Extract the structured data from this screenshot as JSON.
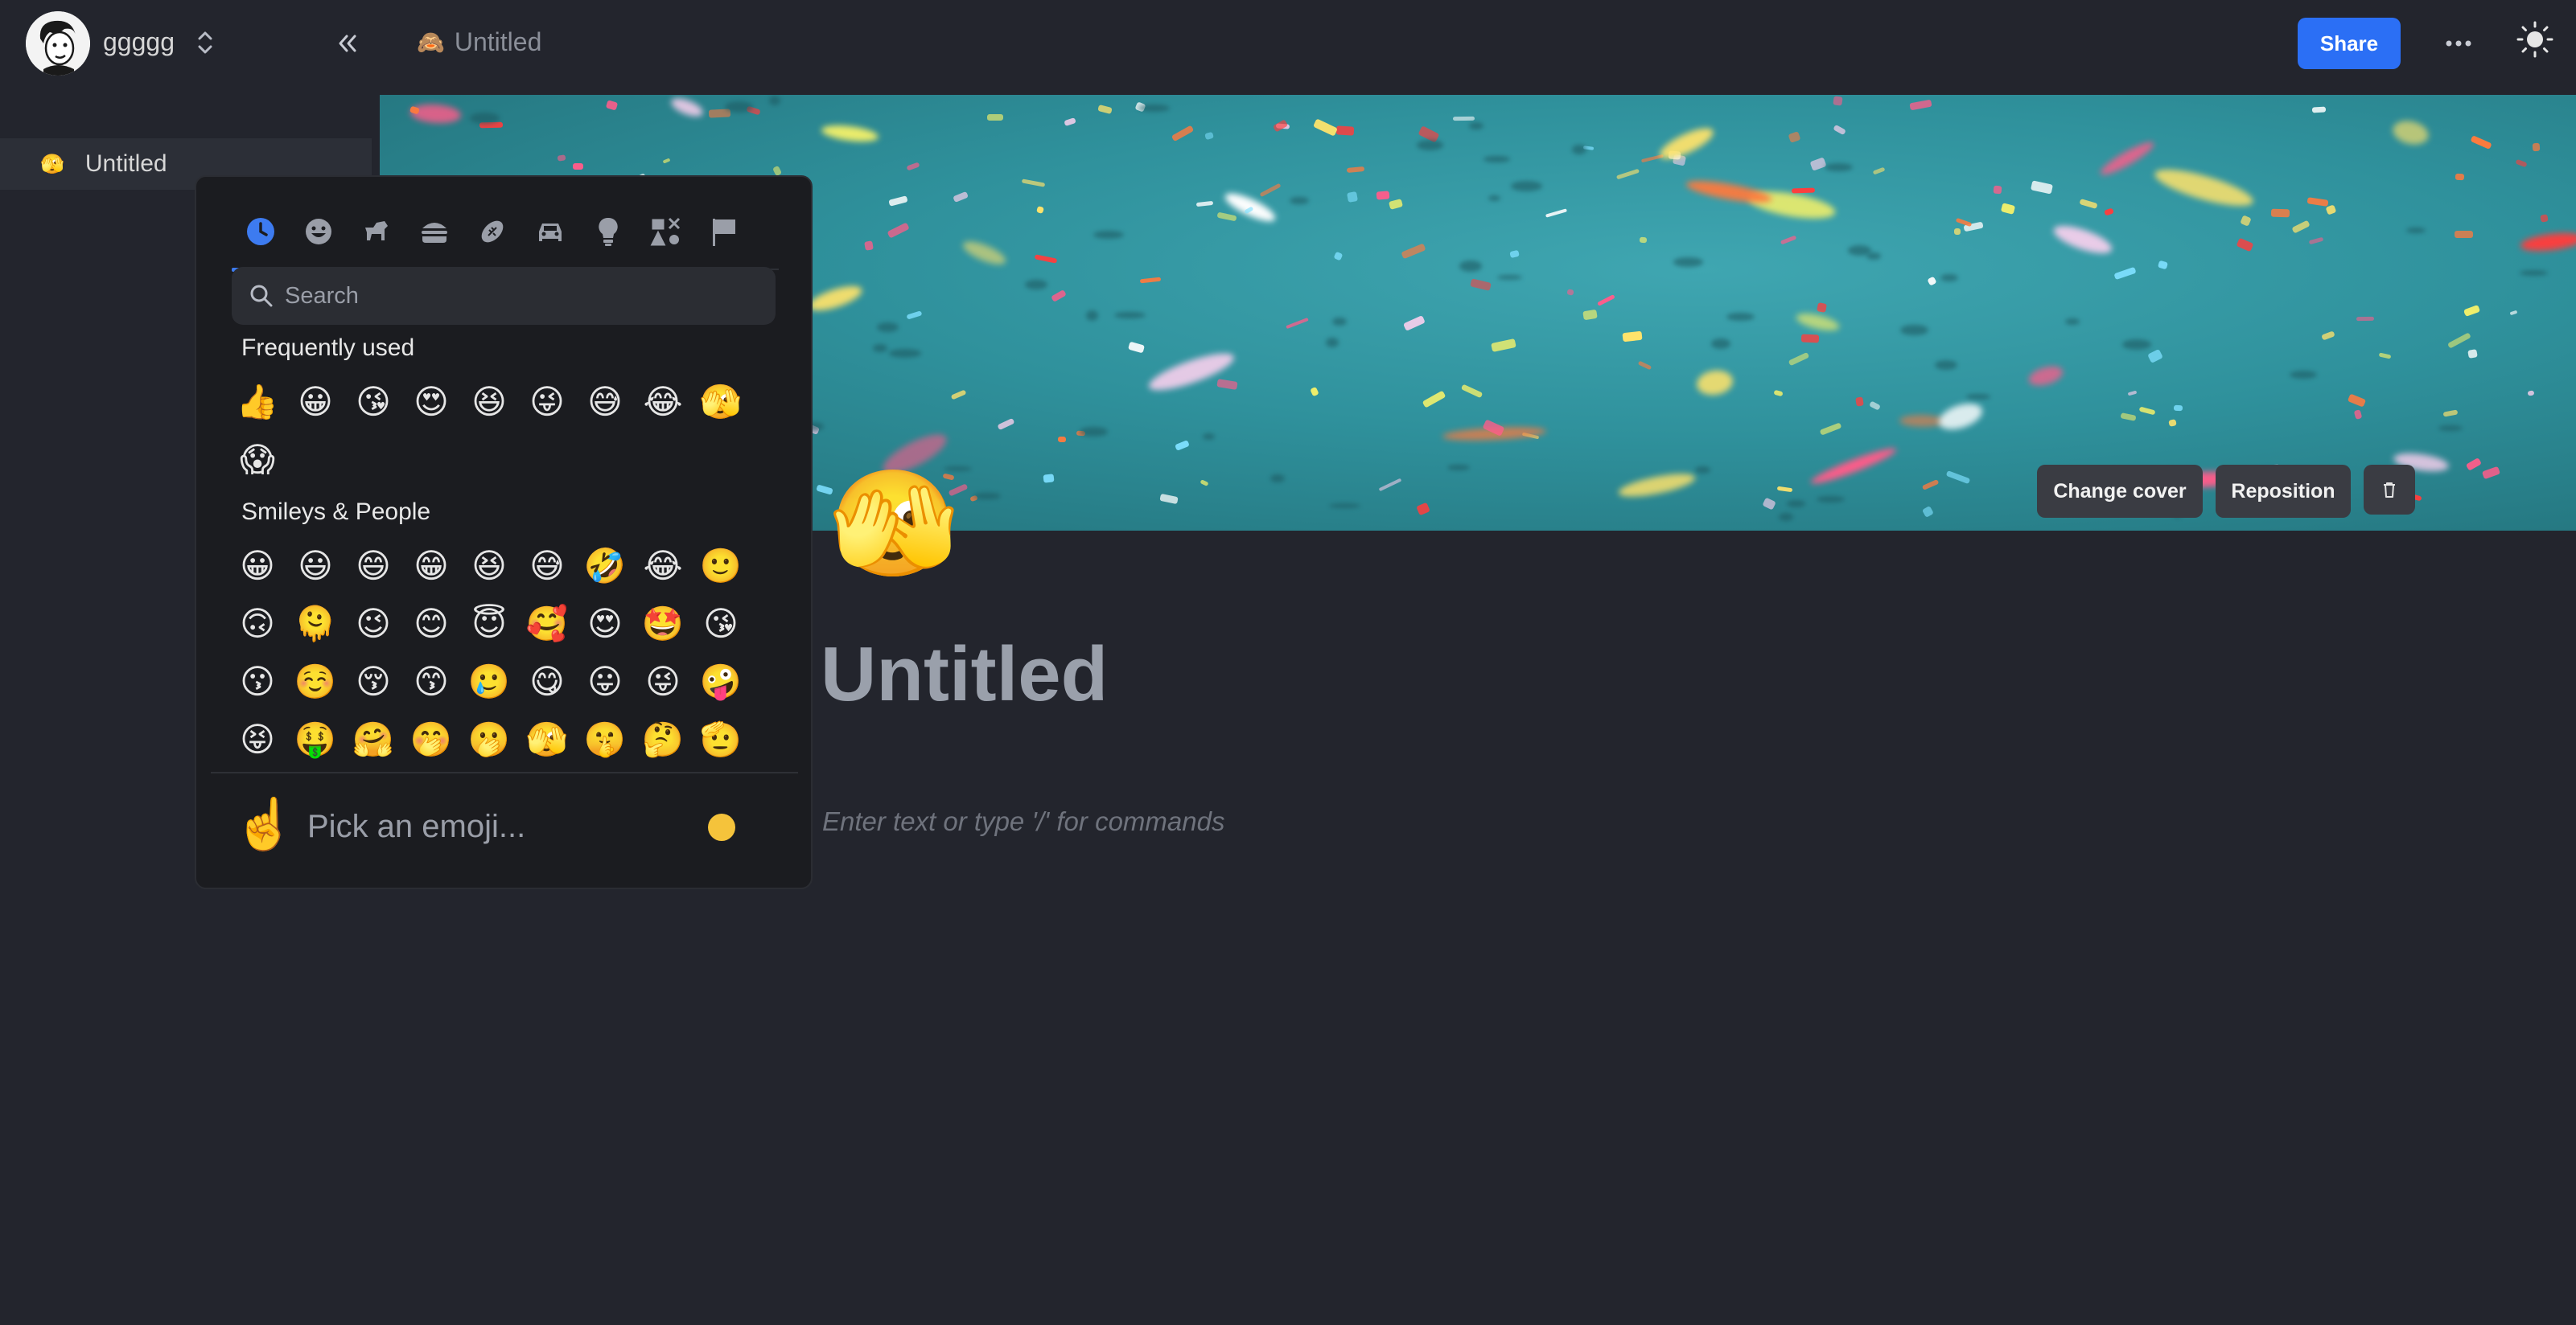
{
  "header": {
    "workspace_name": "ggggg",
    "breadcrumb_icon": "🙈",
    "breadcrumb_title": "Untitled",
    "share_label": "Share"
  },
  "sidebar": {
    "pages": [
      {
        "icon": "🫣",
        "label": "Untitled"
      }
    ]
  },
  "cover": {
    "change_label": "Change cover",
    "reposition_label": "Reposition"
  },
  "page": {
    "icon": "🫣",
    "title": "Untitled",
    "editor_placeholder": "Enter text or type '/' for commands"
  },
  "emoji_picker": {
    "categories": [
      "recent",
      "smileys",
      "animals",
      "food",
      "activities",
      "travel",
      "objects",
      "symbols",
      "flags"
    ],
    "active_category": "recent",
    "search_placeholder": "Search",
    "sections": [
      {
        "label": "Frequently used",
        "emojis": [
          "👍",
          "😀",
          "😘",
          "😍",
          "😆",
          "😜",
          "😅",
          "😂",
          "🫣",
          "😱"
        ]
      },
      {
        "label": "Smileys & People",
        "emojis": [
          "😀",
          "😃",
          "😄",
          "😁",
          "😆",
          "😅",
          "🤣",
          "😂",
          "🙂",
          "🙃",
          "🫠",
          "😉",
          "😊",
          "😇",
          "🥰",
          "😍",
          "🤩",
          "😘",
          "😗",
          "☺️",
          "😚",
          "😙",
          "🥲",
          "😋",
          "😛",
          "😜",
          "🤪",
          "😝",
          "🤑",
          "🤗",
          "🤭",
          "🫢",
          "🫣",
          "🤫",
          "🤔",
          "🫡"
        ]
      }
    ],
    "preview_emoji": "☝️",
    "preview_text": "Pick an emoji...",
    "accent_color": "#3d7bf0"
  },
  "colors": {
    "background": "#23252d",
    "share_button": "#2b6ff5",
    "cover": "#2f919c"
  }
}
